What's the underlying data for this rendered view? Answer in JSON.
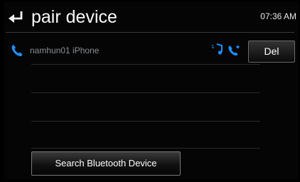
{
  "header": {
    "title": "pair device",
    "time": "07:36 AM",
    "back_icon": "back-arrow-icon"
  },
  "device": {
    "name": "namhun01 iPhone",
    "icons": [
      "phone-icon",
      "music-icon",
      "call-icon"
    ]
  },
  "buttons": {
    "delete": "Del",
    "search": "Search Bluetooth Device"
  },
  "colors": {
    "accent": "#1e90ff",
    "background": "#000000",
    "device_text": "#8a8f96"
  }
}
